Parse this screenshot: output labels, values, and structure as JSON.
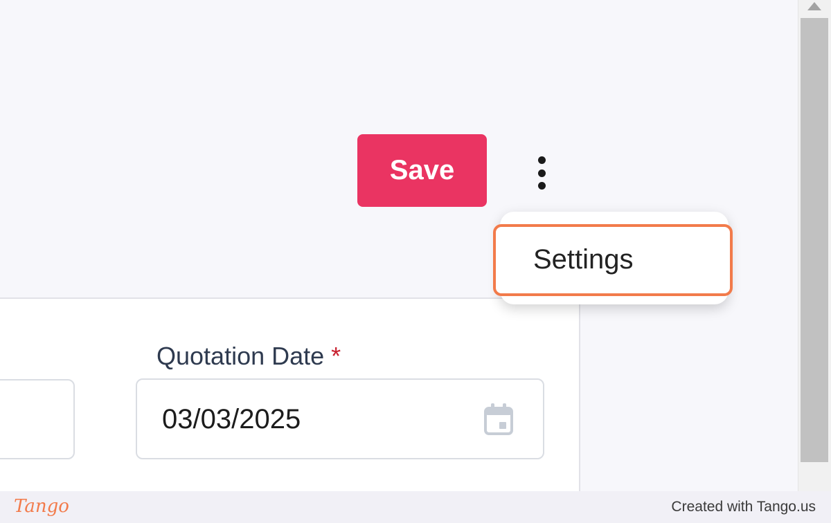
{
  "toolbar": {
    "save_label": "Save",
    "more_icon": "more-vertical-icon"
  },
  "menu": {
    "items": [
      {
        "label": "Settings"
      }
    ]
  },
  "form": {
    "quotation_date": {
      "label": "Quotation Date",
      "required_mark": "*",
      "value": "03/03/2025",
      "icon": "calendar-icon"
    }
  },
  "footer": {
    "logo_text": "Tango",
    "credit": "Created with Tango.us"
  },
  "colors": {
    "save_button": "#ea3462",
    "highlight": "#f27b4b",
    "required": "#c8202f"
  }
}
